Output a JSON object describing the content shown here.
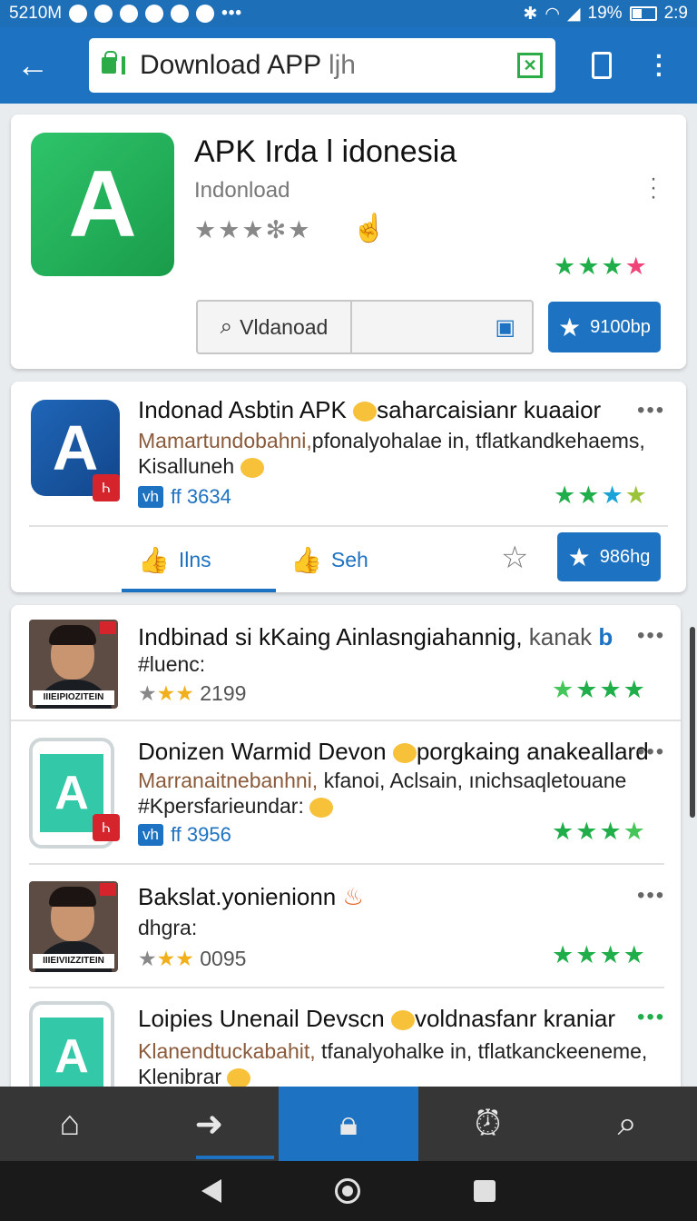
{
  "status_bar": {
    "time_left": "5210M",
    "battery": "19%",
    "time_right": "2:9",
    "dots": "•••"
  },
  "toolbar": {
    "back_icon": "arrow-left-icon",
    "url_text": "Download APP",
    "url_suffix": "ljh"
  },
  "hero": {
    "title": "APK Irda l idonesia",
    "subtitle": "Indonload",
    "search_label": "Vldanoad",
    "install_label": "9100bp",
    "stars_left": "★★★✻★",
    "stars_right": [
      "★",
      "★",
      "★",
      "★"
    ]
  },
  "featured": {
    "title": "Indonad Asbtin APK ",
    "title_tail": "saharcaisianr kuaaior",
    "desc_line1": "Mamartundobahni,",
    "desc_line1_tail": "pfonalyohalae in, tflatkandkehaems,",
    "desc_line2": "Kisalluneh",
    "badge_vh": "vh",
    "badge_text": "ff 3634",
    "icon_badge": "Ꮒ",
    "action1": "Ilns",
    "action2": "Seh",
    "button_label": "986hg"
  },
  "list": [
    {
      "title": "Indbinad si kKaing Ainlasngiahannig,",
      "title_tail": "kanak",
      "line2": "#luenc:",
      "count": "2199",
      "caption": "IIIEIPIOZITEIN"
    },
    {
      "title": "Donizen Warmid Devon ",
      "title_tail": "porgkaing anakeallard",
      "desc1": "Marranaitnebanhni,",
      "desc1_tail": "kfanoi, Aclsain, ınichsaqletouane",
      "desc2": "#Kpersfarieundar:",
      "badge_vh": "vh",
      "badge_text": "ff 3956",
      "icon_badge": "Ꮒ"
    },
    {
      "title": "Bakslat.yonienionn",
      "line2": "dhgra:",
      "count": "0095",
      "caption": "IIIEIVIIZZITEIN"
    },
    {
      "title": "Loipies Unenail Devscn ",
      "title_tail": "voldnasfanr kraniar",
      "desc1": "Klanendtuckabahit,",
      "desc1_tail": "tfanalyohalke in, tflatkanckeeneme,",
      "desc2": "Klenibrar"
    }
  ],
  "bottom_nav": {
    "home": "home-icon",
    "forward": "forward-arrow-icon",
    "lock": "lock-icon",
    "alarm": "alarm-icon",
    "search": "search-icon"
  },
  "colors": {
    "primary": "#1d72c2",
    "star_green": "#1fae4a",
    "pink": "#f0437a"
  }
}
